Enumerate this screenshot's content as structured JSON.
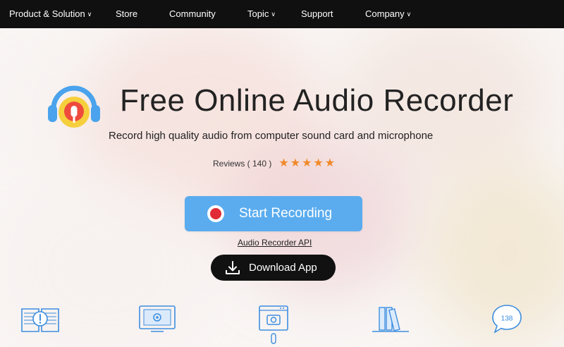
{
  "nav": {
    "items": [
      {
        "label": "Product & Solution",
        "has_dropdown": true
      },
      {
        "label": "Store",
        "has_dropdown": false
      },
      {
        "label": "Community",
        "has_dropdown": false
      },
      {
        "label": "Topic",
        "has_dropdown": true
      },
      {
        "label": "Support",
        "has_dropdown": false
      },
      {
        "label": "Company",
        "has_dropdown": true
      }
    ],
    "dropdown_glyph": "∨"
  },
  "hero": {
    "logo_icon": "headphones-record-icon",
    "title": "Free Online Audio Recorder",
    "subtitle": "Record high quality audio from computer sound card and microphone",
    "reviews_label": "Reviews ( 140 )",
    "rating_stars": 5,
    "star_glyph": "★"
  },
  "actions": {
    "start_label": "Start Recording",
    "api_link": "Audio Recorder API",
    "download_label": "Download App"
  },
  "features": {
    "icons": [
      "book-info-icon",
      "settings-monitor-icon",
      "camera-window-icon",
      "library-books-icon",
      "chat-bubble-icon"
    ],
    "chat_count": "138"
  },
  "colors": {
    "nav_bg": "#101010",
    "primary_button": "#5aacef",
    "record_red": "#e02a36",
    "star": "#f0892a",
    "download_button": "#111111",
    "icon_blue": "#3d8ee0"
  }
}
